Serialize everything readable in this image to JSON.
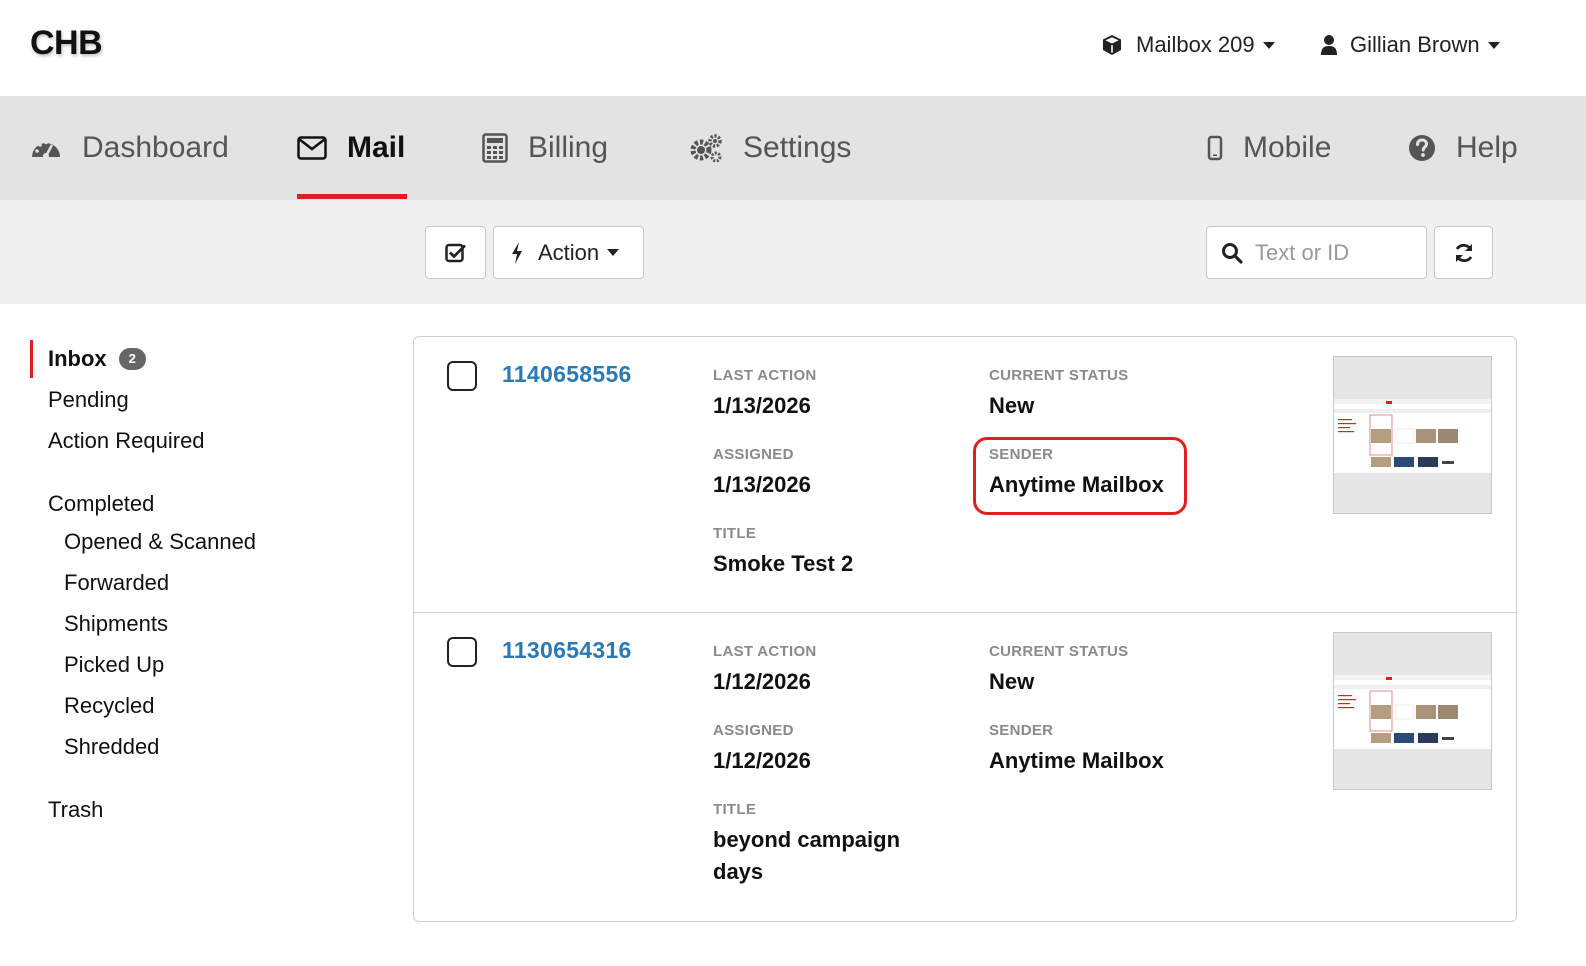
{
  "brand": "CHB",
  "header": {
    "mailbox_label": "Mailbox 209",
    "user_label": "Gillian Brown"
  },
  "nav": {
    "dashboard": "Dashboard",
    "mail": "Mail",
    "billing": "Billing",
    "settings": "Settings",
    "mobile": "Mobile",
    "help": "Help",
    "active": "Mail"
  },
  "toolbar": {
    "action_label": "Action",
    "search_placeholder": "Text or ID"
  },
  "sidebar": {
    "inbox": "Inbox",
    "inbox_count": "2",
    "pending": "Pending",
    "action_required": "Action Required",
    "completed": "Completed",
    "opened_scanned": "Opened & Scanned",
    "forwarded": "Forwarded",
    "shipments": "Shipments",
    "picked_up": "Picked Up",
    "recycled": "Recycled",
    "shredded": "Shredded",
    "trash": "Trash"
  },
  "labels": {
    "last_action": "LAST ACTION",
    "assigned": "ASSIGNED",
    "title": "TITLE",
    "current_status": "CURRENT STATUS",
    "sender": "SENDER"
  },
  "mail": [
    {
      "id": "1140658556",
      "last_action": "1/13/2026",
      "assigned": "1/13/2026",
      "title": "Smoke Test 2",
      "status": "New",
      "sender": "Anytime Mailbox"
    },
    {
      "id": "1130654316",
      "last_action": "1/12/2026",
      "assigned": "1/12/2026",
      "title": "beyond campaign days",
      "status": "New",
      "sender": "Anytime Mailbox"
    }
  ],
  "colors": {
    "accent_red": "#e02020",
    "link_blue": "#2a7ab8",
    "nav_bg": "#e3e3e3",
    "toolbar_bg": "#f0f0f0"
  }
}
